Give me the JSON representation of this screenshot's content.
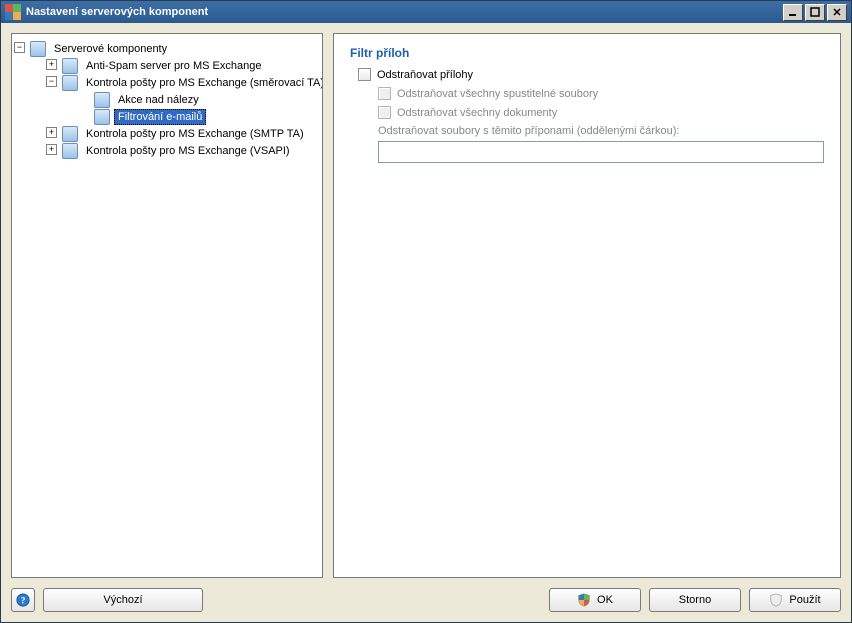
{
  "window": {
    "title": "Nastavení serverových komponent"
  },
  "tree": {
    "root": {
      "label": "Serverové komponenty",
      "children": [
        {
          "label": "Anti-Spam server pro MS Exchange",
          "expander": "+"
        },
        {
          "label": "Kontrola pošty pro MS Exchange (směrovací TA)",
          "expander": "−",
          "children": [
            {
              "label": "Akce nad nálezy"
            },
            {
              "label": "Filtrování e-mailů",
              "selected": true
            }
          ]
        },
        {
          "label": "Kontrola pošty pro MS Exchange (SMTP TA)",
          "expander": "+"
        },
        {
          "label": "Kontrola pošty pro MS Exchange (VSAPI)",
          "expander": "+"
        }
      ]
    }
  },
  "content": {
    "section_title": "Filtr příloh",
    "remove_attachments": {
      "label": "Odstraňovat přílohy",
      "checked": false
    },
    "remove_executables": {
      "label": "Odstraňovat všechny spustitelné soubory",
      "checked": false
    },
    "remove_documents": {
      "label": "Odstraňovat všechny dokumenty",
      "checked": false
    },
    "extensions_label": "Odstraňovat soubory s těmito příponami (oddělenými čárkou):",
    "extensions_value": ""
  },
  "buttons": {
    "help_icon": "help-icon",
    "defaults": "Výchozí",
    "ok": "OK",
    "cancel": "Storno",
    "apply": "Použít"
  }
}
